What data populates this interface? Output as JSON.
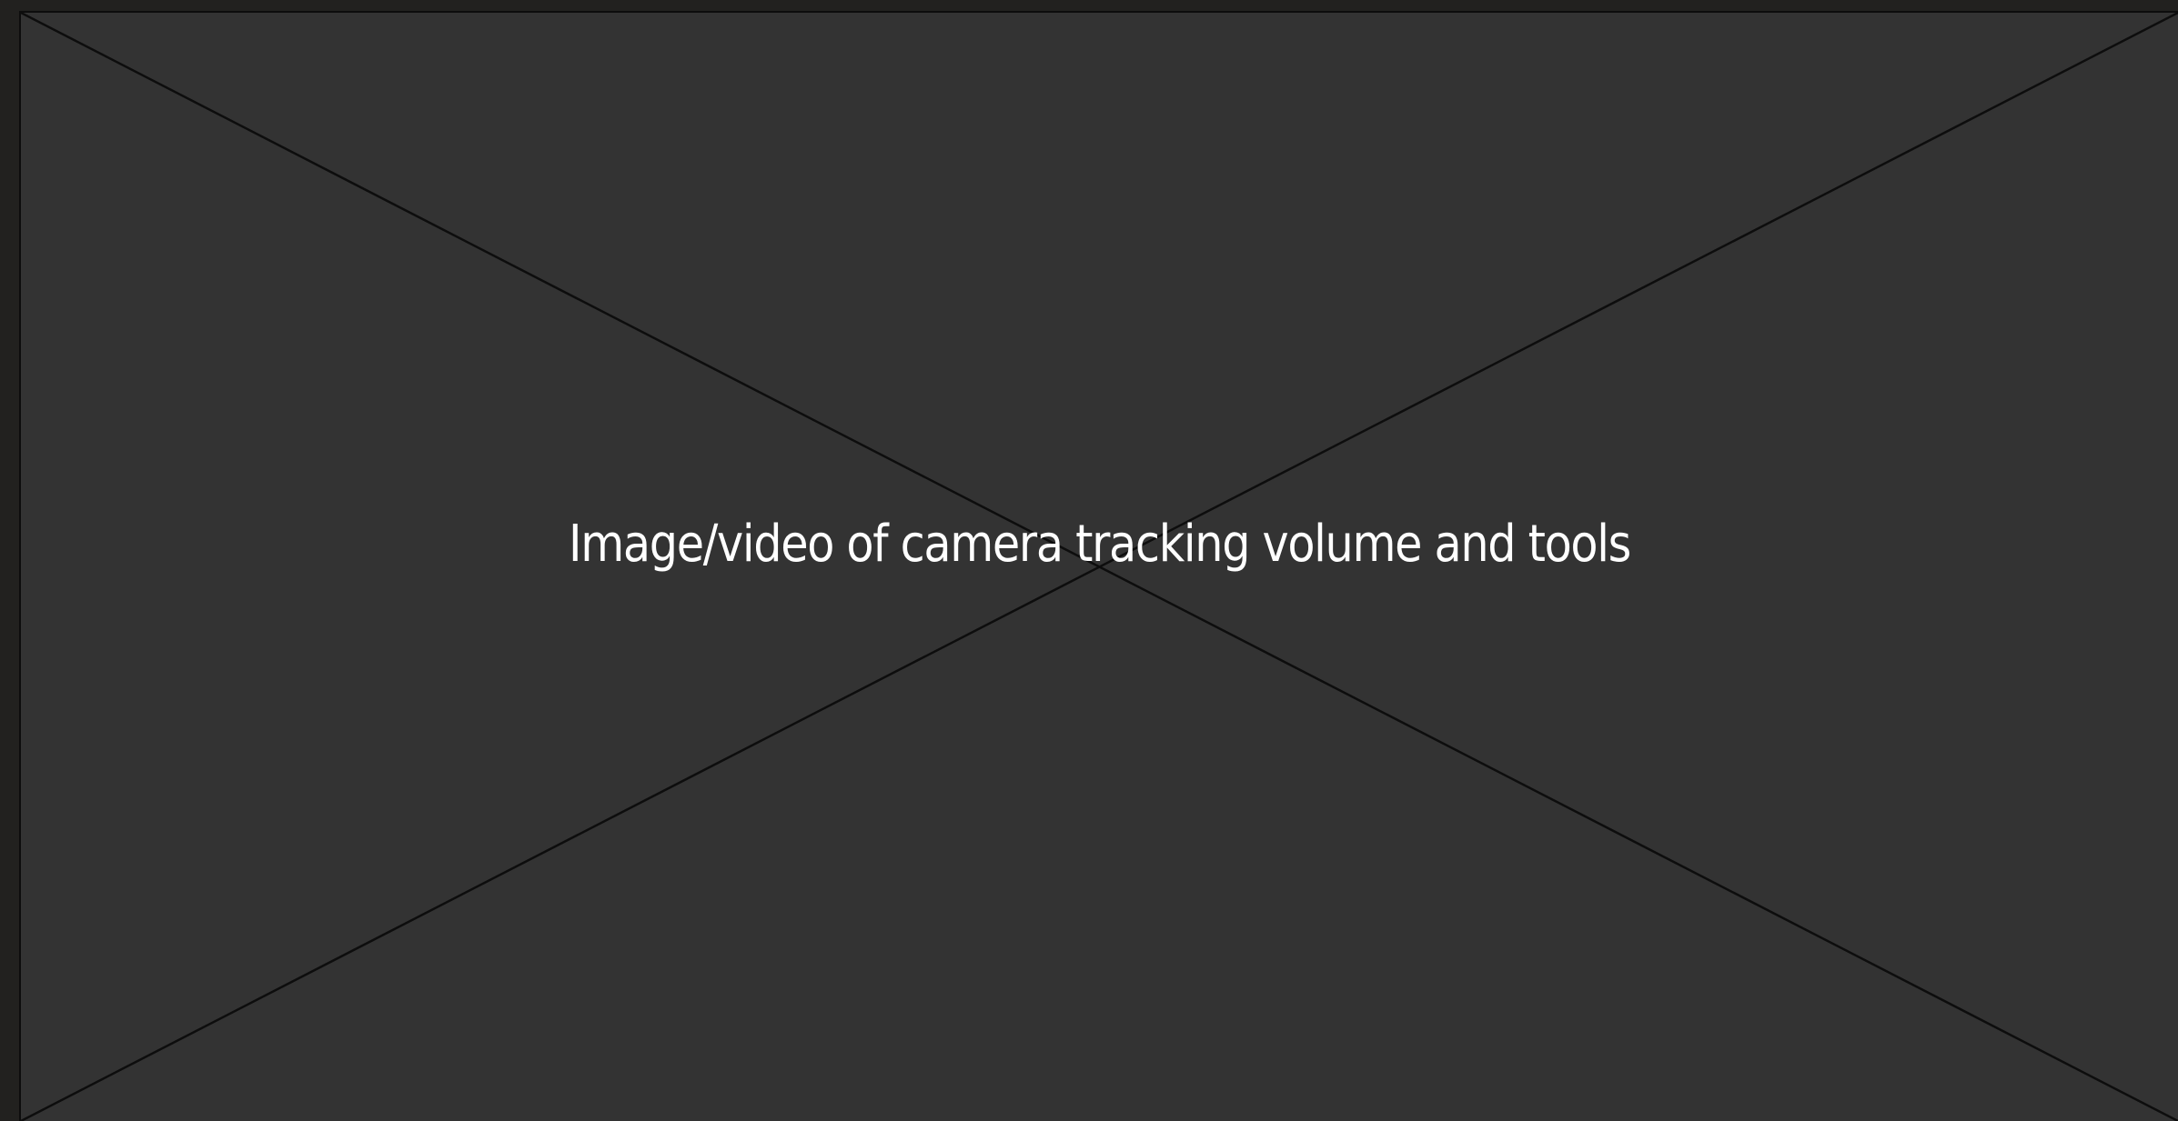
{
  "placeholder": {
    "caption": "Image/video of camera tracking volume and tools",
    "background_color": "#333333",
    "line_color": "#0d0d0d",
    "text_color": "#ffffff"
  },
  "page": {
    "background_color": "#22211f"
  }
}
